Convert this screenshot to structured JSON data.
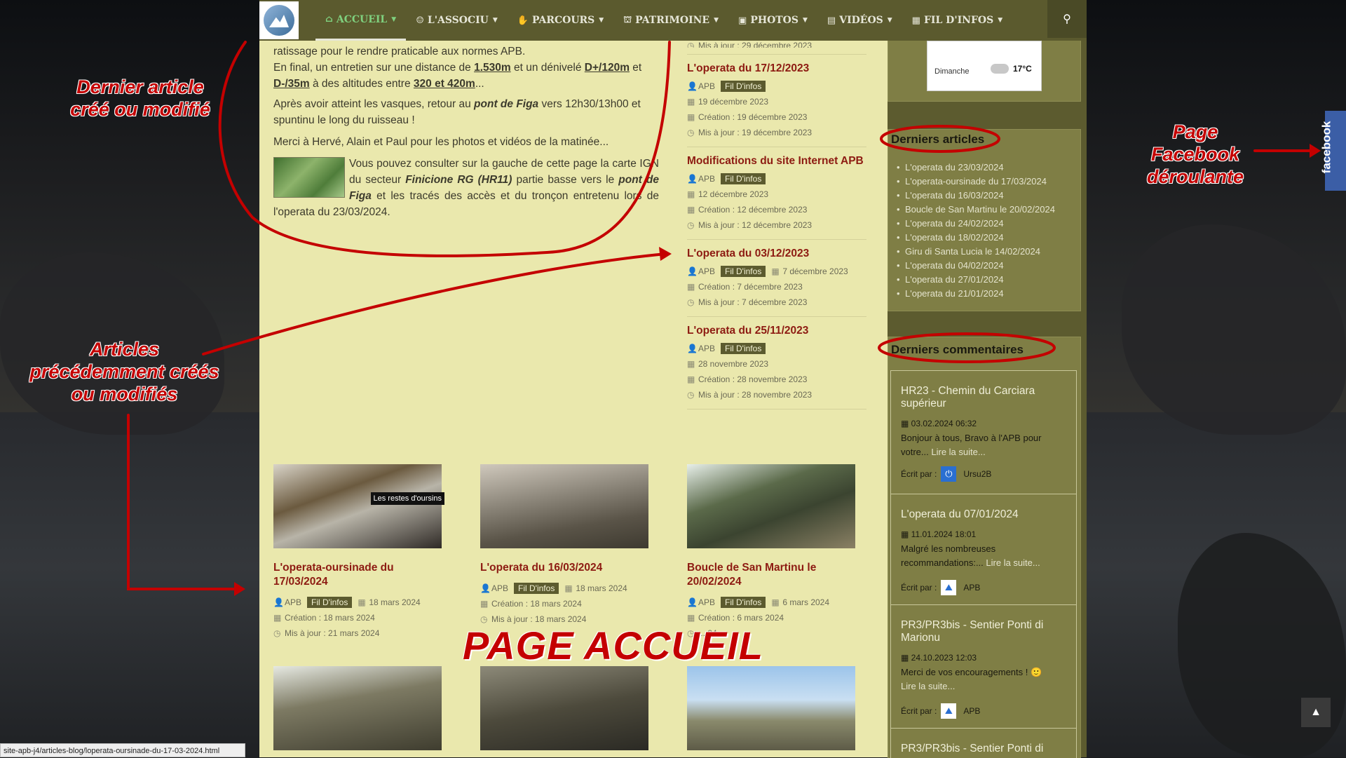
{
  "nav": {
    "items": [
      {
        "icon": "home-icon",
        "glyph": "⌂",
        "label": "ACCUEIL"
      },
      {
        "icon": "users-icon",
        "glyph": "☺",
        "label": "L'ASSOCIU"
      },
      {
        "icon": "thumbs-up-icon",
        "glyph": "✋",
        "label": "PARCOURS"
      },
      {
        "icon": "bank-icon",
        "glyph": "⛫",
        "label": "PATRIMOINE"
      },
      {
        "icon": "image-icon",
        "glyph": "▣",
        "label": "PHOTOS"
      },
      {
        "icon": "film-icon",
        "glyph": "▤",
        "label": "VIDÉOS"
      },
      {
        "icon": "newspaper-icon",
        "glyph": "▦",
        "label": "FIL D'INFOS"
      }
    ]
  },
  "lead": {
    "p1_start": "ratissage pour le rendre praticable aux normes APB.",
    "p1_mid": "En final, un entretien sur une distance de ",
    "dist": "1.530m",
    "p1_mid2": " et un dénivelé ",
    "deniv_pos": "D+/120m",
    "p1_mid3": " et ",
    "deniv_neg": "D-/35m",
    "p1_mid4": " à des altitudes entre ",
    "alt": "320 et 420m",
    "p1_end": "...",
    "p2a": "Après avoir atteint les vasques, retour au ",
    "p2b": "pont de Figa",
    "p2c": " vers 12h30/13h00 et spuntinu le long du ruisseau !",
    "p3": "Merci à Hervé, Alain et Paul pour les photos et vidéos de la matinée...",
    "p4a": "Vous pouvez consulter sur la gauche de cette page la carte IGN du secteur ",
    "p4b": "Finicione RG (HR11)",
    "p4c": " partie basse vers le ",
    "p4d": "pont de Figa",
    "p4e": " et les tracés des accès et du tronçon entretenu lors de l'operata du 23/03/2024."
  },
  "articles": [
    {
      "title": "",
      "meta_top": "Mis à jour : 29 décembre 2023"
    },
    {
      "title": "L'operata du 17/12/2023",
      "author": "APB",
      "cat": "Fil D'infos",
      "date": "19 décembre 2023",
      "created": "Création : 19 décembre 2023",
      "updated": "Mis à jour : 19 décembre 2023"
    },
    {
      "title": "Modifications du site Internet APB",
      "author": "APB",
      "cat": "Fil D'infos",
      "date": "12 décembre 2023",
      "created": "Création : 12 décembre 2023",
      "updated": "Mis à jour : 12 décembre 2023"
    },
    {
      "title": "L'operata du 03/12/2023",
      "author": "APB",
      "cat": "Fil D'infos",
      "date": "7 décembre 2023",
      "created": "Création : 7 décembre 2023",
      "updated": "Mis à jour : 7 décembre 2023"
    },
    {
      "title": "L'operata du 25/11/2023",
      "author": "APB",
      "cat": "Fil D'infos",
      "date": "28 novembre 2023",
      "created": "Création : 28 novembre 2023",
      "updated": "Mis à jour : 28 novembre 2023"
    }
  ],
  "cards": [
    {
      "title": "L'operata-oursinade du 17/03/2024",
      "author": "APB",
      "cat": "Fil D'infos",
      "date": "18 mars 2024",
      "created": "Création : 18 mars 2024",
      "updated": "Mis à jour : 21 mars 2024",
      "tooltip": "Les restes d'oursins"
    },
    {
      "title": "L'operata du 16/03/2024",
      "author": "APB",
      "cat": "Fil D'infos",
      "date": "18 mars 2024",
      "created": "Création : 18 mars 2024",
      "updated": "Mis à jour : 18 mars 2024"
    },
    {
      "title": "Boucle de San Martinu le 20/02/2024",
      "author": "APB",
      "cat": "Fil D'infos",
      "date": "6 mars 2024",
      "created": "Création : 6 mars 2024",
      "updated": "... 24"
    }
  ],
  "page_label": "PAGE ACCUEIL",
  "weather": {
    "day": "Dimanche",
    "temp": "17°C"
  },
  "recent": {
    "title": "Derniers articles",
    "items": [
      "L'operata du 23/03/2024",
      "L'operata-oursinade du 17/03/2024",
      "L'operata du 16/03/2024",
      "Boucle de San Martinu le 20/02/2024",
      "L'operata du 24/02/2024",
      "L'operata du 18/02/2024",
      "Giru di Santa Lucia le 14/02/2024",
      "L'operata du 04/02/2024",
      "L'operata du 27/01/2024",
      "L'operata du 21/01/2024"
    ]
  },
  "comments": {
    "title": "Derniers commentaires",
    "items": [
      {
        "title": "HR23 - Chemin du Carciara supérieur",
        "date": "03.02.2024 06:32",
        "text": "Bonjour à tous, Bravo à l'APB pour votre...",
        "more": "Lire la suite...",
        "by": "Écrit par :",
        "author": "Ursu2B"
      },
      {
        "title": "L'operata du 07/01/2024",
        "date": "11.01.2024 18:01",
        "text": "Malgré les nombreuses recommandations:...",
        "more": "Lire la suite...",
        "by": "Écrit par :",
        "author": "APB"
      },
      {
        "title": "PR3/PR3bis - Sentier Ponti di Marionu",
        "date": "24.10.2023 12:03",
        "text": "Merci de vos encouragements ! 🙂",
        "more": "Lire la suite...",
        "by": "Écrit par :",
        "author": "APB"
      },
      {
        "title": "PR3/PR3bis - Sentier Ponti di"
      }
    ]
  },
  "annotations": {
    "a1": "Dernier article créé ou modifié",
    "a2": "Articles précédemment créés ou modifiés",
    "a3": "Page Facebook déroulante"
  },
  "facebook_tab": "facebook",
  "status_url": "site-apb-j4/articles-blog/loperata-oursinade-du-17-03-2024.html",
  "colors": {
    "accent": "#5c5b2f",
    "title": "#8d1b12",
    "annotation": "#c40000",
    "panel": "#eae8ad"
  }
}
